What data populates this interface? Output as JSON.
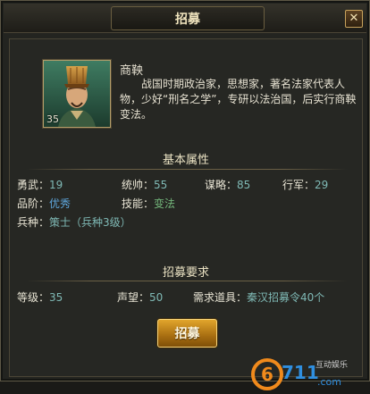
{
  "dialog": {
    "title": "招募",
    "close_glyph": "✕"
  },
  "hero": {
    "name": "商鞅",
    "level": "35",
    "description": "战国时期政治家，思想家，著名法家代表人物，少好“刑名之学”，专研以法治国，后实行商鞅变法。"
  },
  "attributes": {
    "title": "基本属性",
    "bravery_label": "勇武：",
    "bravery_value": "19",
    "command_label": "统帅：",
    "command_value": "55",
    "strategy_label": "谋略：",
    "strategy_value": "85",
    "march_label": "行军：",
    "march_value": "29",
    "grade_label": "品阶：",
    "grade_value": "优秀",
    "skill_label": "技能：",
    "skill_value": "变法",
    "troop_label": "兵种：",
    "troop_value": "策士（兵种3级）"
  },
  "requirements": {
    "title": "招募要求",
    "level_label": "等级：",
    "level_value": "35",
    "prestige_label": "声望：",
    "prestige_value": "50",
    "item_label": "需求道具：",
    "item_value": "秦汉招募令40个"
  },
  "button": {
    "label": "招募"
  },
  "watermark": {
    "number": "6711",
    "suffix": ".com",
    "tag": "互动娱乐",
    "colors": {
      "orange": "#f08a1c",
      "blue": "#2f8fe0"
    }
  },
  "colors": {
    "attr_value": "#7fb9b5",
    "grade": "#5ea6dc",
    "skill": "#73b57a",
    "button": "#c98a1e"
  }
}
